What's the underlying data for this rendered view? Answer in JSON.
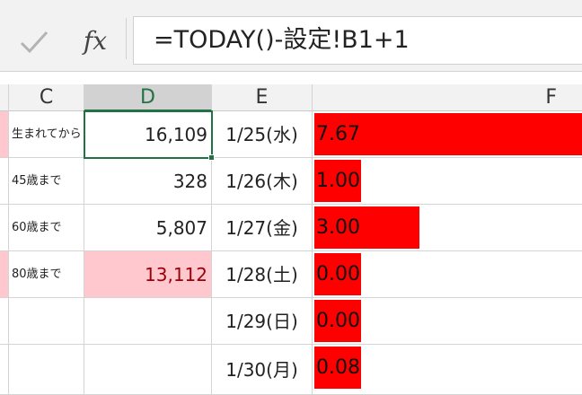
{
  "formula_bar": {
    "check_icon": "check-icon",
    "fx_label": "fx",
    "formula": "=TODAY()-設定!B1+1"
  },
  "columns": {
    "c": "C",
    "d": "D",
    "e": "E",
    "f": "F"
  },
  "rows": [
    {
      "label": "生まれてから",
      "value": "16,109",
      "date": "1/25(水)",
      "bar_label": "7.67",
      "bar_value": 7.67
    },
    {
      "label": "45歳まで",
      "value": "328",
      "date": "1/26(木)",
      "bar_label": "1.00",
      "bar_value": 1.0
    },
    {
      "label": "60歳まで",
      "value": "5,807",
      "date": "1/27(金)",
      "bar_label": "3.00",
      "bar_value": 3.0
    },
    {
      "label": "80歳まで",
      "value": "13,112",
      "date": "1/28(土)",
      "bar_label": "0.00",
      "bar_value": 0.0
    },
    {
      "label": "",
      "value": "",
      "date": "1/29(日)",
      "bar_label": "0.00",
      "bar_value": 0.0
    },
    {
      "label": "",
      "value": "",
      "date": "1/30(月)",
      "bar_label": "0.08",
      "bar_value": 0.08
    }
  ],
  "colors": {
    "bar": "#ff0000",
    "selection": "#217346",
    "highlight_fill": "#ffc7ce",
    "highlight_text": "#9c0006"
  }
}
